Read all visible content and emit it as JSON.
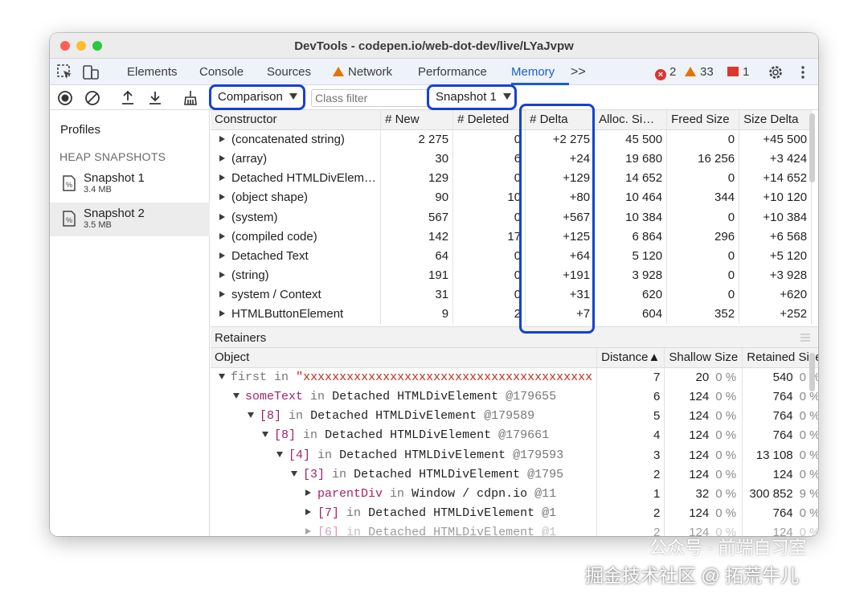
{
  "window": {
    "title": "DevTools - codepen.io/web-dot-dev/live/LYaJvpw"
  },
  "tabs": [
    {
      "label": "Elements"
    },
    {
      "label": "Console"
    },
    {
      "label": "Sources"
    },
    {
      "label": "Network",
      "icon": "warning-icon"
    },
    {
      "label": "Performance"
    },
    {
      "label": "Memory",
      "active": true
    }
  ],
  "more_tabs": ">>",
  "status": {
    "errors": "2",
    "warnings": "33",
    "issues": "1"
  },
  "toolbar": {
    "view_select": "Comparison",
    "filter_placeholder": "Class filter",
    "snapshot_select": "Snapshot 1"
  },
  "sidebar": {
    "title": "Profiles",
    "section": "HEAP SNAPSHOTS",
    "snapshots": [
      {
        "name": "Snapshot 1",
        "size": "3.4 MB"
      },
      {
        "name": "Snapshot 2",
        "size": "3.5 MB",
        "selected": true
      }
    ]
  },
  "comparison": {
    "headers": [
      "Constructor",
      "# New",
      "# Deleted",
      "# Delta",
      "Alloc. Si…",
      "Freed Size",
      "Size Delta"
    ],
    "rows": [
      [
        "(concatenated string)",
        "2 275",
        "0",
        "+2 275",
        "45 500",
        "0",
        "+45 500"
      ],
      [
        "(array)",
        "30",
        "6",
        "+24",
        "19 680",
        "16 256",
        "+3 424"
      ],
      [
        "Detached HTMLDivElem…",
        "129",
        "0",
        "+129",
        "14 652",
        "0",
        "+14 652"
      ],
      [
        "(object shape)",
        "90",
        "10",
        "+80",
        "10 464",
        "344",
        "+10 120"
      ],
      [
        "(system)",
        "567",
        "0",
        "+567",
        "10 384",
        "0",
        "+10 384"
      ],
      [
        "(compiled code)",
        "142",
        "17",
        "+125",
        "6 864",
        "296",
        "+6 568"
      ],
      [
        "Detached Text",
        "64",
        "0",
        "+64",
        "5 120",
        "0",
        "+5 120"
      ],
      [
        "(string)",
        "191",
        "0",
        "+191",
        "3 928",
        "0",
        "+3 928"
      ],
      [
        "system / Context",
        "31",
        "0",
        "+31",
        "620",
        "0",
        "+620"
      ],
      [
        "HTMLButtonElement",
        "9",
        "2",
        "+7",
        "604",
        "352",
        "+252"
      ]
    ]
  },
  "retainers": {
    "title": "Retainers",
    "headers": [
      "Object",
      "Distance▲",
      "Shallow Size",
      "Retained Size"
    ],
    "rows": [
      {
        "prop": "first",
        "kw": "in",
        "rest": "\"xxxxxxxxxxxxxxxxxxxxxxxxxxxxxxxxxxxxxxxx",
        "distance": "7",
        "shallow": "20",
        "shallow_pct": "0 %",
        "retained": "540",
        "retained_pct": "0 %"
      },
      {
        "prop": "someText",
        "kw": "in",
        "rest": "Detached HTMLDivElement",
        "id": "@179655",
        "distance": "6",
        "shallow": "124",
        "shallow_pct": "0 %",
        "retained": "764",
        "retained_pct": "0 %"
      },
      {
        "prop": "[8]",
        "kw": "in",
        "rest": "Detached HTMLDivElement",
        "id": "@179589",
        "distance": "5",
        "shallow": "124",
        "shallow_pct": "0 %",
        "retained": "764",
        "retained_pct": "0 %"
      },
      {
        "prop": "[8]",
        "kw": "in",
        "rest": "Detached HTMLDivElement",
        "id": "@179661",
        "distance": "4",
        "shallow": "124",
        "shallow_pct": "0 %",
        "retained": "764",
        "retained_pct": "0 %"
      },
      {
        "prop": "[4]",
        "kw": "in",
        "rest": "Detached HTMLDivElement",
        "id": "@179593",
        "distance": "3",
        "shallow": "124",
        "shallow_pct": "0 %",
        "retained": "13 108",
        "retained_pct": "0 %"
      },
      {
        "prop": "[3]",
        "kw": "in",
        "rest": "Detached HTMLDivElement",
        "id": "@1795",
        "distance": "2",
        "shallow": "124",
        "shallow_pct": "0 %",
        "retained": "124",
        "retained_pct": "0 %"
      },
      {
        "prop": "parentDiv",
        "kw": "in",
        "rest": "Window / cdpn.io",
        "id": "@11",
        "distance": "1",
        "shallow": "32",
        "shallow_pct": "0 %",
        "retained": "300 852",
        "retained_pct": "9 %"
      },
      {
        "prop": "[7]",
        "kw": "in",
        "rest": "Detached HTMLDivElement",
        "id": "@1",
        "distance": "2",
        "shallow": "124",
        "shallow_pct": "0 %",
        "retained": "764",
        "retained_pct": "0 %"
      },
      {
        "prop": "[6]",
        "kw": "in",
        "rest": "Detached HTMLDivElement",
        "id": "@1",
        "distance": "2",
        "shallow": "124",
        "shallow_pct": "0 %",
        "retained": "124",
        "retained_pct": "0 %"
      }
    ]
  },
  "watermark": {
    "line1": "公众号 · 前端自习室",
    "line2": "掘金技术社区 @ 拓荒牛儿"
  }
}
